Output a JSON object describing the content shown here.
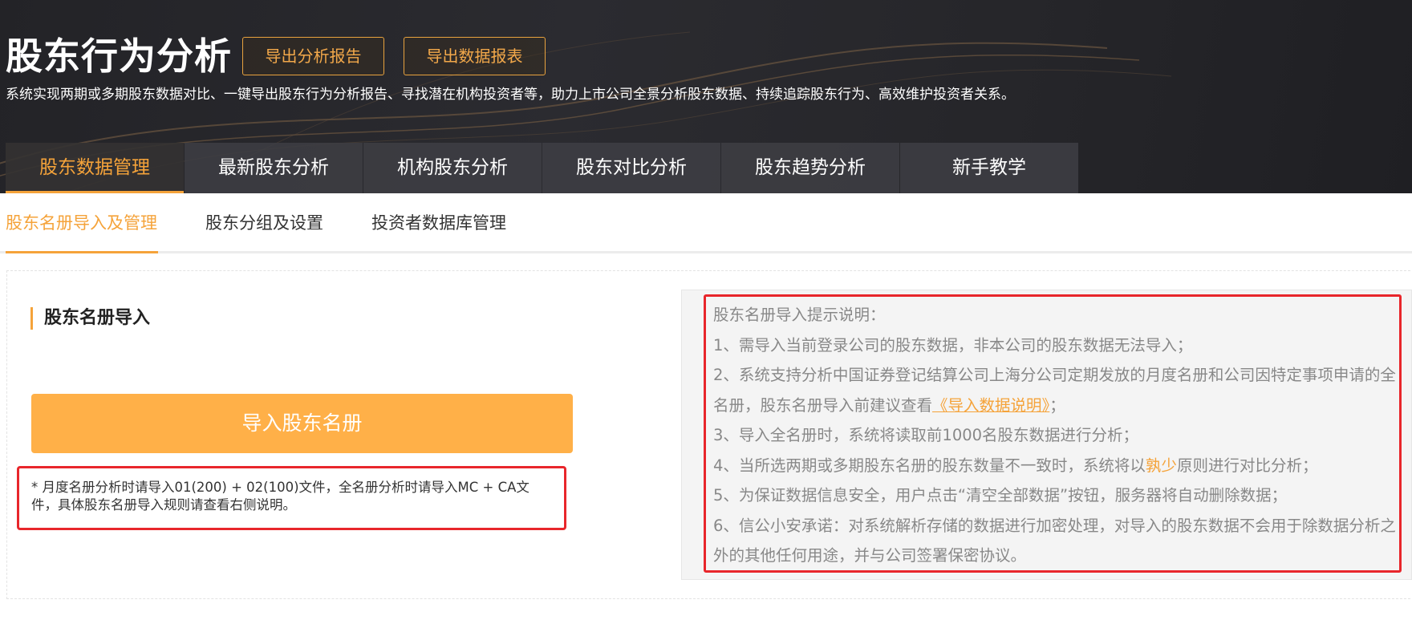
{
  "header": {
    "title": "股东行为分析",
    "export_report_label": "导出分析报告",
    "export_data_label": "导出数据报表",
    "subtitle": "系统实现两期或多期股东数据对比、一键导出股东行为分析报告、寻找潜在机构投资者等，助力上市公司全景分析股东数据、持续追踪股东行为、高效维护投资者关系。"
  },
  "main_tabs": [
    {
      "label": "股东数据管理",
      "active": true
    },
    {
      "label": "最新股东分析"
    },
    {
      "label": "机构股东分析"
    },
    {
      "label": "股东对比分析"
    },
    {
      "label": "股东趋势分析"
    },
    {
      "label": "新手教学"
    }
  ],
  "sub_tabs": [
    {
      "label": "股东名册导入及管理",
      "active": true
    },
    {
      "label": "股东分组及设置"
    },
    {
      "label": "投资者数据库管理"
    }
  ],
  "import_section": {
    "title": "股东名册导入",
    "button_label": "导入股东名册",
    "note": "* 月度名册分析时请导入01(200) + 02(100)文件，全名册分析时请导入MC + CA文件，具体股东名册导入规则请查看右侧说明。"
  },
  "hints": {
    "heading": "股东名册导入提示说明：",
    "item1": "1、需导入当前登录公司的股东数据，非本公司的股东数据无法导入；",
    "item2_pre": "2、系统支持分析中国证券登记结算公司上海分公司定期发放的月度名册和公司因特定事项申请的全名册，股东名册导入前建议查看",
    "item2_link": "《导入数据说明》",
    "item2_post": "；",
    "item3": "3、导入全名册时，系统将读取前1000名股东数据进行分析；",
    "item4_pre": "4、当所选两期或多期股东名册的股东数量不一致时，系统将以",
    "item4_highlight": "孰少",
    "item4_post": "原则进行对比分析；",
    "item5": "5、为保证数据信息安全，用户点击“清空全部数据”按钮，服务器将自动删除数据；",
    "item6": "6、信公小安承诺：对系统解析存储的数据进行加密处理，对导入的股东数据不会用于除数据分析之外的其他任何用途，并与公司签署保密协议。"
  },
  "colors": {
    "accent": "#f5a33a",
    "import_button": "#ffb048",
    "highlight_border": "#e8262b",
    "banner": "#26262a"
  }
}
